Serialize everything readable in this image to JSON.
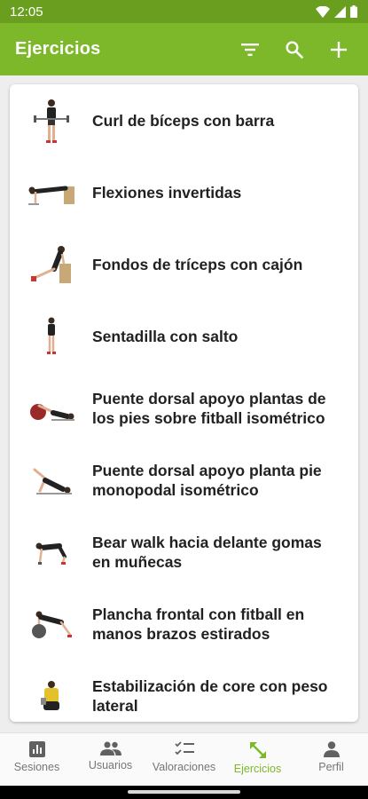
{
  "status_bar": {
    "time": "12:05"
  },
  "app_bar": {
    "title": "Ejercicios"
  },
  "exercises": [
    {
      "name": "Curl de bíceps con barra",
      "thumb": "barbell-curl"
    },
    {
      "name": "Flexiones invertidas",
      "thumb": "inverted-pushup"
    },
    {
      "name": "Fondos de tríceps con cajón",
      "thumb": "triceps-dip-box"
    },
    {
      "name": "Sentadilla con salto",
      "thumb": "jump-squat"
    },
    {
      "name": "Puente dorsal apoyo plantas de los pies sobre fitball isométrico",
      "thumb": "bridge-fitball"
    },
    {
      "name": "Puente dorsal apoyo planta pie monopodal isométrico",
      "thumb": "single-leg-bridge"
    },
    {
      "name": "Bear walk hacia delante gomas en muñecas",
      "thumb": "bear-walk"
    },
    {
      "name": "Plancha frontal con fitball en manos brazos estirados",
      "thumb": "plank-fitball"
    },
    {
      "name": "Estabilización de core con peso lateral",
      "thumb": "core-weight"
    }
  ],
  "bottom_nav": [
    {
      "label": "Sesiones",
      "icon": "chart-icon",
      "active": false
    },
    {
      "label": "Usuarios",
      "icon": "people-icon",
      "active": false
    },
    {
      "label": "Valoraciones",
      "icon": "checklist-icon",
      "active": false
    },
    {
      "label": "Ejercicios",
      "icon": "expand-arrows-icon",
      "active": true
    },
    {
      "label": "Perfil",
      "icon": "person-icon",
      "active": false
    }
  ],
  "colors": {
    "primary": "#7cb82a",
    "status_bar": "#6a9e1f",
    "active_nav": "#7cb82a"
  }
}
